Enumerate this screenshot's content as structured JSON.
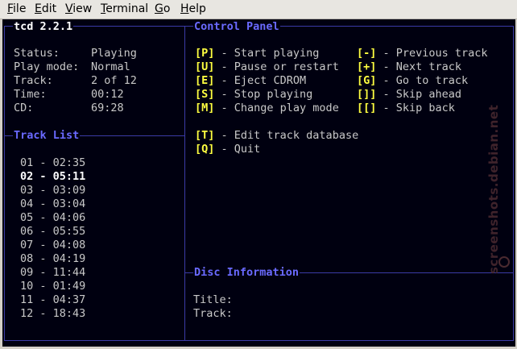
{
  "menu": [
    {
      "first": "F",
      "rest": "ile"
    },
    {
      "first": "E",
      "rest": "dit"
    },
    {
      "first": "V",
      "rest": "iew"
    },
    {
      "first": "T",
      "rest": "erminal"
    },
    {
      "first": "G",
      "rest": "o"
    },
    {
      "first": "H",
      "rest": "elp"
    }
  ],
  "app": {
    "title": "tcd 2.2.1"
  },
  "status": {
    "rows": [
      {
        "label": "Status:",
        "value": "Playing"
      },
      {
        "label": "Play mode:",
        "value": "Normal"
      },
      {
        "label": "Track:",
        "value": "2 of 12"
      },
      {
        "label": "Time:",
        "value": "00:12"
      },
      {
        "label": "CD:",
        "value": "69:28"
      }
    ]
  },
  "track_list": {
    "title": "Track List",
    "current_index": 1,
    "tracks": [
      "01 - 02:35",
      "02 - 05:11",
      "03 - 03:09",
      "04 - 03:04",
      "05 - 04:06",
      "06 - 05:55",
      "07 - 04:08",
      "08 - 04:19",
      "09 - 11:44",
      "10 - 01:49",
      "11 - 04:37",
      "12 - 18:43"
    ]
  },
  "control_panel": {
    "title": "Control Panel",
    "left": [
      {
        "key": "[P]",
        "desc": " - Start playing"
      },
      {
        "key": "[U]",
        "desc": " - Pause or restart"
      },
      {
        "key": "[E]",
        "desc": " - Eject CDROM"
      },
      {
        "key": "[S]",
        "desc": " - Stop playing"
      },
      {
        "key": "[M]",
        "desc": " - Change play mode"
      }
    ],
    "right": [
      {
        "key": "[-]",
        "desc": " - Previous track"
      },
      {
        "key": "[+]",
        "desc": " - Next track"
      },
      {
        "key": "[G]",
        "desc": " - Go to track"
      },
      {
        "key": "[]]",
        "desc": " - Skip ahead"
      },
      {
        "key": "[[]",
        "desc": " - Skip back"
      }
    ],
    "extra": [
      {
        "key": "[T]",
        "desc": " - Edit track database"
      },
      {
        "key": "[Q]",
        "desc": " - Quit"
      }
    ]
  },
  "disc_info": {
    "title": "Disc Information",
    "title_label": "Title:",
    "track_label": "Track:"
  },
  "watermark": "screenshots.debian.net",
  "colors": {
    "background": "#000010",
    "border": "#3b3ba6",
    "panel_title": "#6a6aff",
    "key": "#ffff40",
    "text": "#c8c8c8",
    "highlight": "#ffffff"
  }
}
